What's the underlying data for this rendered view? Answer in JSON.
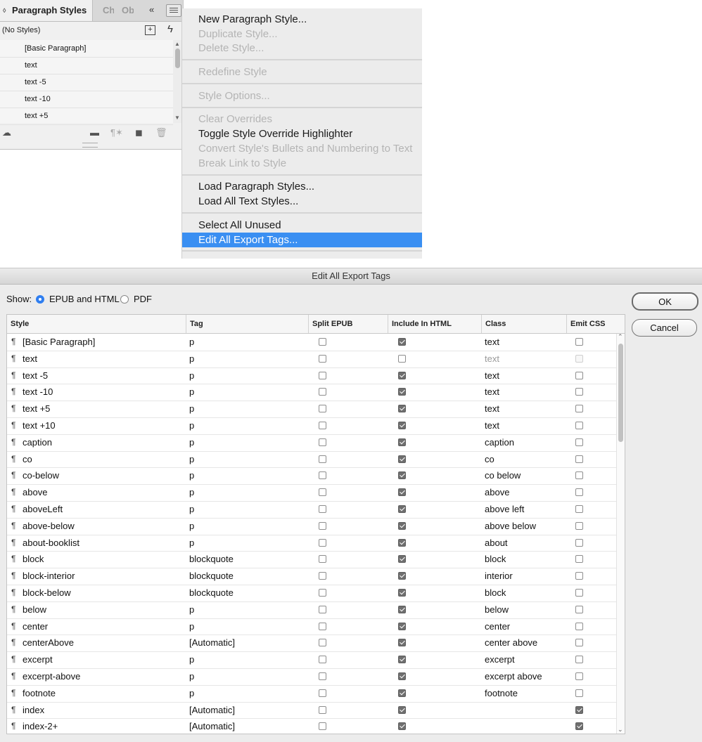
{
  "panel": {
    "tabs": [
      "Paragraph Styles",
      "Ch",
      "Ob"
    ],
    "collapse_glyph": "«",
    "no_styles": "(No Styles)",
    "styles": [
      "[Basic Paragraph]",
      "text",
      "text -5",
      "text -10",
      "text +5"
    ]
  },
  "menu": {
    "items": [
      {
        "label": "New Paragraph Style...",
        "enabled": true
      },
      {
        "label": "Duplicate Style...",
        "enabled": false
      },
      {
        "label": "Delete Style...",
        "enabled": false
      },
      {
        "label": "Redefine Style",
        "enabled": false
      },
      {
        "label": "Style Options...",
        "enabled": false
      },
      {
        "label": "Clear Overrides",
        "enabled": false
      },
      {
        "label": "Toggle Style Override Highlighter",
        "enabled": true
      },
      {
        "label": "Convert Style's Bullets and Numbering to Text",
        "enabled": false
      },
      {
        "label": "Break Link to Style",
        "enabled": false
      },
      {
        "label": "Load Paragraph Styles...",
        "enabled": true
      },
      {
        "label": "Load All Text Styles...",
        "enabled": true
      },
      {
        "label": "Select All Unused",
        "enabled": true
      },
      {
        "label": "Edit All Export Tags...",
        "enabled": true,
        "highlighted": true
      }
    ]
  },
  "dialog": {
    "title": "Edit All Export Tags",
    "show_label": "Show:",
    "radio_epub": "EPUB and HTML",
    "radio_pdf": "PDF",
    "selected": "EPUB and HTML",
    "ok": "OK",
    "cancel": "Cancel",
    "columns": [
      "Style",
      "Tag",
      "Split EPUB",
      "Include In HTML",
      "Class",
      "Emit CSS"
    ],
    "rows": [
      {
        "style": "[Basic Paragraph]",
        "tag": "p",
        "split": false,
        "include": true,
        "class": "text",
        "emit": false
      },
      {
        "style": "text",
        "tag": "p",
        "split": false,
        "include": false,
        "class": "text",
        "emit": false,
        "dim": true
      },
      {
        "style": "text -5",
        "tag": "p",
        "split": false,
        "include": true,
        "class": "text",
        "emit": false
      },
      {
        "style": "text -10",
        "tag": "p",
        "split": false,
        "include": true,
        "class": "text",
        "emit": false
      },
      {
        "style": "text +5",
        "tag": "p",
        "split": false,
        "include": true,
        "class": "text",
        "emit": false
      },
      {
        "style": "text +10",
        "tag": "p",
        "split": false,
        "include": true,
        "class": "text",
        "emit": false
      },
      {
        "style": "caption",
        "tag": "p",
        "split": false,
        "include": true,
        "class": "caption",
        "emit": false
      },
      {
        "style": "co",
        "tag": "p",
        "split": false,
        "include": true,
        "class": "co",
        "emit": false
      },
      {
        "style": "co-below",
        "tag": "p",
        "split": false,
        "include": true,
        "class": "co below",
        "emit": false
      },
      {
        "style": "above",
        "tag": "p",
        "split": false,
        "include": true,
        "class": "above",
        "emit": false
      },
      {
        "style": "aboveLeft",
        "tag": "p",
        "split": false,
        "include": true,
        "class": "above left",
        "emit": false
      },
      {
        "style": "above-below",
        "tag": "p",
        "split": false,
        "include": true,
        "class": "above below",
        "emit": false
      },
      {
        "style": "about-booklist",
        "tag": "p",
        "split": false,
        "include": true,
        "class": "about",
        "emit": false
      },
      {
        "style": "block",
        "tag": "blockquote",
        "split": false,
        "include": true,
        "class": "block",
        "emit": false
      },
      {
        "style": "block-interior",
        "tag": "blockquote",
        "split": false,
        "include": true,
        "class": "interior",
        "emit": false
      },
      {
        "style": "block-below",
        "tag": "blockquote",
        "split": false,
        "include": true,
        "class": "block",
        "emit": false
      },
      {
        "style": "below",
        "tag": "p",
        "split": false,
        "include": true,
        "class": "below",
        "emit": false
      },
      {
        "style": "center",
        "tag": "p",
        "split": false,
        "include": true,
        "class": "center",
        "emit": false
      },
      {
        "style": "centerAbove",
        "tag": "[Automatic]",
        "split": false,
        "include": true,
        "class": "center above",
        "emit": false
      },
      {
        "style": "excerpt",
        "tag": "p",
        "split": false,
        "include": true,
        "class": "excerpt",
        "emit": false
      },
      {
        "style": "excerpt-above",
        "tag": "p",
        "split": false,
        "include": true,
        "class": "excerpt above",
        "emit": false
      },
      {
        "style": "footnote",
        "tag": "p",
        "split": false,
        "include": true,
        "class": "footnote",
        "emit": false
      },
      {
        "style": "index",
        "tag": "[Automatic]",
        "split": false,
        "include": true,
        "class": "",
        "emit": true
      },
      {
        "style": "index-2+",
        "tag": "[Automatic]",
        "split": false,
        "include": true,
        "class": "",
        "emit": true
      }
    ]
  },
  "colors": {
    "highlight": "#3a8ff2",
    "radio_on": "#2f7ef0"
  }
}
